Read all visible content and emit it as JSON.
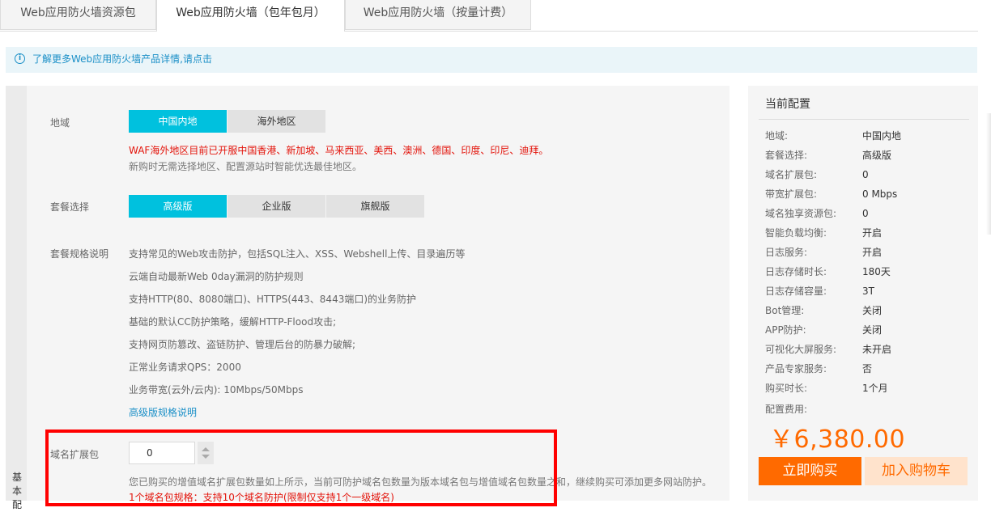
{
  "tabs": [
    {
      "label": "Web应用防火墙资源包",
      "active": false
    },
    {
      "label": "Web应用防火墙（包年包月）",
      "active": true
    },
    {
      "label": "Web应用防火墙（按量计费）",
      "active": false
    }
  ],
  "info": {
    "icon": "info-icon",
    "text": "了解更多Web应用防火墙产品详情,请点击"
  },
  "side_label": "基本配",
  "region": {
    "label": "地域",
    "options": [
      "中国内地",
      "海外地区"
    ],
    "selected": "中国内地",
    "note_red": "WAF海外地区目前已开服中国香港、新加坡、马来西亚、美西、澳洲、德国、印度、印尼、迪拜。",
    "note_gray": "新购时无需选择地区、配置源站时智能优选最佳地区。"
  },
  "plan": {
    "label": "套餐选择",
    "options": [
      "高级版",
      "企业版",
      "旗舰版"
    ],
    "selected": "高级版"
  },
  "spec": {
    "label": "套餐规格说明",
    "lines": [
      "支持常见的Web攻击防护，包括SQL注入、XSS、Webshell上传、目录遍历等",
      "云端自动最新Web 0day漏洞的防护规则",
      "支持HTTP(80、8080端口)、HTTPS(443、8443端口)的业务防护",
      "基础的默认CC防护策略，缓解HTTP-Flood攻击;",
      "支持网页防篡改、盗链防护、管理后台的防暴力破解;",
      "正常业务请求QPS：2000",
      "业务带宽(云外/云内): 10Mbps/50Mbps"
    ],
    "link": "高级版规格说明"
  },
  "domain_pack": {
    "label": "域名扩展包",
    "value": "0",
    "note_gray": "您已购买的增值域名扩展包数量如上所示，当前可防护域名包数量为版本域名包与增值域名包数量之和，继续购买可添加更多网站防护。",
    "note_red": "1个域名包规格：支持10个域名防护(限制仅支持1个一级域名)"
  },
  "summary": {
    "title": "当前配置",
    "rows": [
      {
        "key": "地域:",
        "value": "中国内地"
      },
      {
        "key": "套餐选择:",
        "value": "高级版"
      },
      {
        "key": "域名扩展包:",
        "value": "0"
      },
      {
        "key": "带宽扩展包:",
        "value": "0 Mbps"
      },
      {
        "key": "域名独享资源包:",
        "value": "0"
      },
      {
        "key": "智能负载均衡:",
        "value": "开启"
      },
      {
        "key": "日志服务:",
        "value": "开启"
      },
      {
        "key": "日志存储时长:",
        "value": "180天"
      },
      {
        "key": "日志存储容量:",
        "value": "3T"
      },
      {
        "key": "Bot管理:",
        "value": "关闭"
      },
      {
        "key": "APP防护:",
        "value": "关闭"
      },
      {
        "key": "可视化大屏服务:",
        "value": "未开启"
      },
      {
        "key": "产品专家服务:",
        "value": "否"
      },
      {
        "key": "购买时长:",
        "value": "1个月"
      }
    ],
    "fee_label": "配置费用:",
    "price": "￥6,380.00",
    "buy_label": "立即购买",
    "cart_label": "加入购物车"
  },
  "colors": {
    "accent": "#00c1de",
    "buy": "#ff6a00",
    "cart_bg": "#ffe3cc",
    "warning": "#e3140b",
    "link": "#1a8fc7",
    "highlight_box": "#ff0000"
  }
}
